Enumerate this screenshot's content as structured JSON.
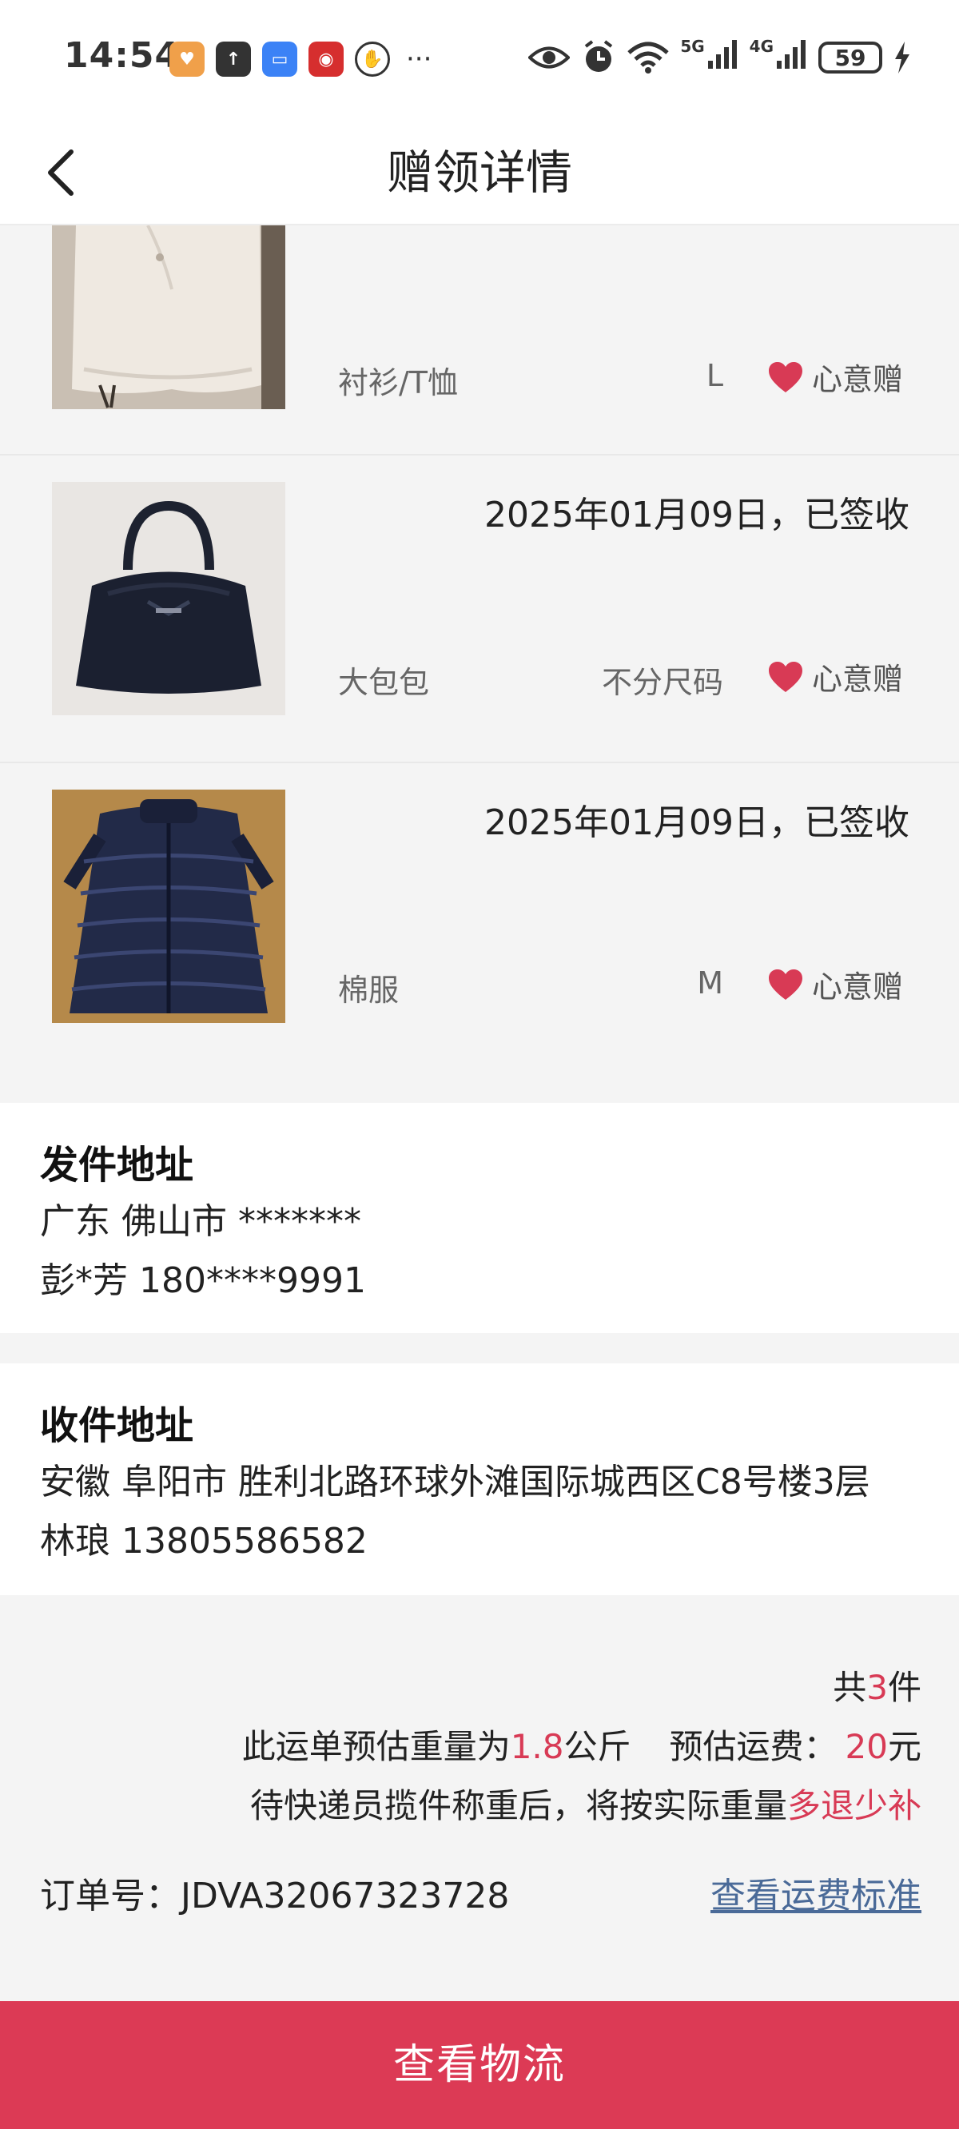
{
  "status_bar": {
    "time": "14:54",
    "battery": "59",
    "net_5g": "5G",
    "net_4g": "4G"
  },
  "nav": {
    "title": "赠领详情"
  },
  "items": [
    {
      "date": "",
      "category": "衬衫/T恤",
      "size": "L",
      "gift_label": "心意赠"
    },
    {
      "date": "2025年01月09日，已签收",
      "category": "大包包",
      "size": "不分尺码",
      "gift_label": "心意赠"
    },
    {
      "date": "2025年01月09日，已签收",
      "category": "棉服",
      "size": "M",
      "gift_label": "心意赠"
    }
  ],
  "sender": {
    "heading": "发件地址",
    "address": "广东 佛山市 *******",
    "contact": "彭*芳 180****9991"
  },
  "receiver": {
    "heading": "收件地址",
    "address": "安徽 阜阳市 胜利北路环球外滩国际城西区C8号楼3层",
    "contact": "林琅 13805586582"
  },
  "summary": {
    "count_prefix": "共",
    "count": "3",
    "count_suffix": "件",
    "weight_prefix": "此运单预估重量为",
    "weight": "1.8",
    "weight_unit": "公斤",
    "fee_label": "预估运费：",
    "fee": "20",
    "fee_unit": "元",
    "note_prefix": "待快递员揽件称重后，将按实际重量",
    "note_highlight": "多退少补",
    "order_label": "订单号：",
    "order_no": "JDVA32067323728",
    "fee_standard_link": "查看运费标准"
  },
  "bottom_button": "查看物流",
  "colors": {
    "accent": "#dc3a55",
    "link": "#4a6a98",
    "background": "#f4f4f4"
  }
}
